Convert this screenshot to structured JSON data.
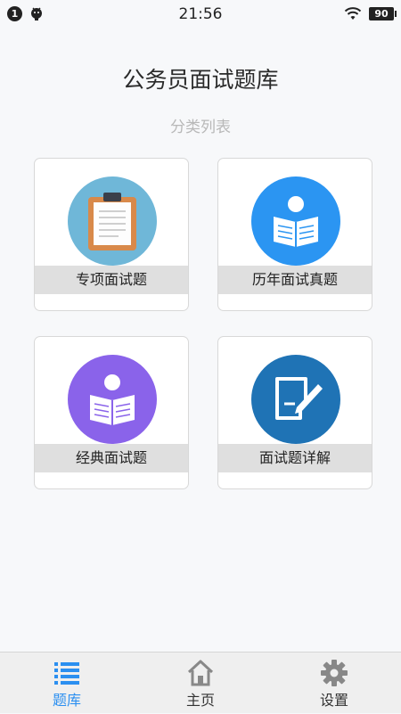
{
  "statusbar": {
    "notification_count": "1",
    "time": "21:56",
    "battery": "90"
  },
  "header": {
    "title": "公务员面试题库",
    "subtitle": "分类列表"
  },
  "categories": [
    {
      "label": "专项面试题",
      "icon": "clipboard-icon",
      "color": "#6fb7d8"
    },
    {
      "label": "历年面试真题",
      "icon": "reader-book-icon",
      "color": "#2b95f2"
    },
    {
      "label": "经典面试题",
      "icon": "reader-book-icon",
      "color": "#8a63ea"
    },
    {
      "label": "面试题详解",
      "icon": "edit-pen-icon",
      "color": "#1f73b5"
    }
  ],
  "tabbar": {
    "items": [
      {
        "label": "题库",
        "icon": "list-icon",
        "active": true
      },
      {
        "label": "主页",
        "icon": "home-icon",
        "active": false
      },
      {
        "label": "设置",
        "icon": "gear-icon",
        "active": false
      }
    ],
    "active_color": "#2b8ff0"
  }
}
